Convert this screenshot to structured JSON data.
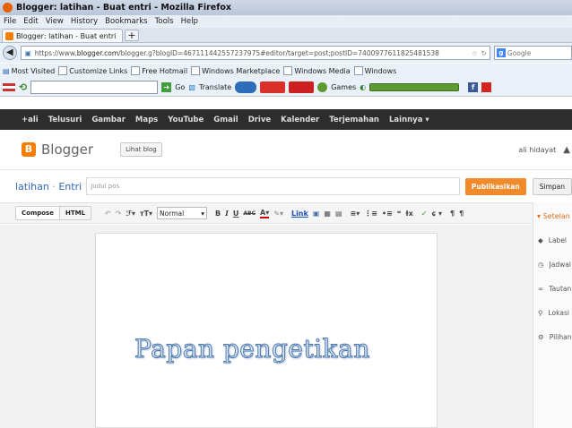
{
  "titlebar": {
    "title": "Blogger: latihan - Buat entri - Mozilla Firefox"
  },
  "menu": [
    "File",
    "Edit",
    "View",
    "History",
    "Bookmarks",
    "Tools",
    "Help"
  ],
  "tabs": [
    {
      "label": "Blogger: latihan - Buat entri"
    }
  ],
  "nav": {
    "url_prefix": "https://www.",
    "url_domain": "blogger.com",
    "url_rest": "/blogger.g?blogID=467111442557237975#editor/target=post;postID=7400977611825481538",
    "search_placeholder": "Google"
  },
  "bookmarks": [
    "Most Visited",
    "Customize Links",
    "Free Hotmail",
    "Windows Marketplace",
    "Windows Media",
    "Windows"
  ],
  "toolbar2": {
    "go": "Go",
    "translate": "Translate",
    "games": "Games"
  },
  "googlebar": [
    "+ali",
    "Telusuri",
    "Gambar",
    "Maps",
    "YouTube",
    "Gmail",
    "Drive",
    "Kalender",
    "Terjemahan",
    "Lainnya"
  ],
  "blogger": {
    "logo": "Blogger",
    "view_blog": "Lihat blog",
    "user": "ali hidayat"
  },
  "post": {
    "blog": "latihan",
    "sep": " · ",
    "entry": "Entri",
    "title_placeholder": "Judul pos",
    "publish": "Publikasikan",
    "save": "Simpan"
  },
  "editor": {
    "compose": "Compose",
    "html": "HTML",
    "format": "Normal",
    "link": "Link",
    "content": "Papan pengetikan"
  },
  "sidebar": {
    "heading": "Setelan",
    "items": [
      {
        "label": "Label",
        "icon": "tag-icon"
      },
      {
        "label": "Jadwal",
        "icon": "clock-icon"
      },
      {
        "label": "Tautan",
        "icon": "link-icon"
      },
      {
        "label": "Lokasi",
        "icon": "pin-icon"
      },
      {
        "label": "Pilihan",
        "icon": "gear-icon"
      }
    ]
  }
}
